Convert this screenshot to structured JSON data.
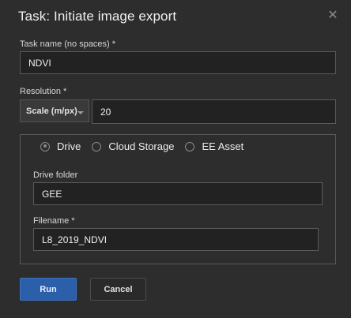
{
  "dialog": {
    "title": "Task: Initiate image export",
    "close_icon": "close-icon"
  },
  "task_name": {
    "label": "Task name (no spaces) *",
    "value": "NDVI"
  },
  "resolution": {
    "label": "Resolution *",
    "mode": "Scale (m/px)",
    "value": "20"
  },
  "destinations": [
    {
      "label": "Drive",
      "selected": true
    },
    {
      "label": "Cloud Storage",
      "selected": false
    },
    {
      "label": "EE Asset",
      "selected": false
    }
  ],
  "drive": {
    "folder_label": "Drive folder",
    "folder_value": "GEE",
    "filename_label": "Filename *",
    "filename_value": "L8_2019_NDVI"
  },
  "buttons": {
    "run": "Run",
    "cancel": "Cancel"
  },
  "colors": {
    "background": "#2d2d2d",
    "run_button": "#2b5faa"
  }
}
